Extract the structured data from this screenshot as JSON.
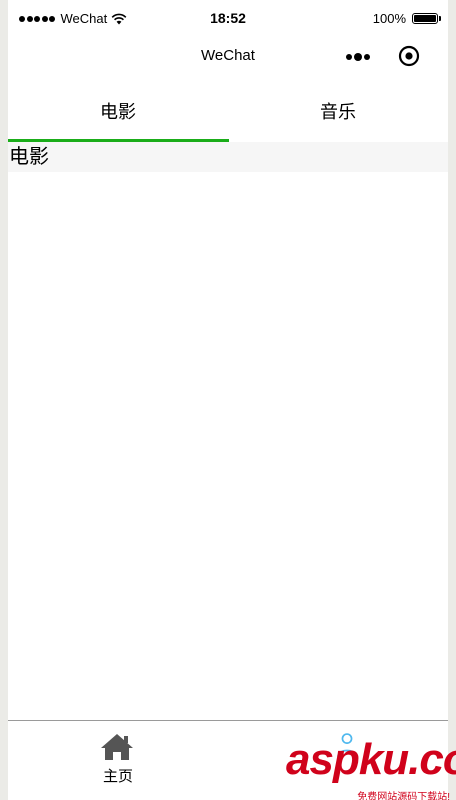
{
  "status_bar": {
    "carrier": "WeChat",
    "time": "18:52",
    "battery": "100%"
  },
  "nav_bar": {
    "title": "WeChat",
    "more_icon": "more-dots-icon",
    "target_icon": "record-target-icon"
  },
  "tabs": [
    {
      "label": "电影",
      "active": true
    },
    {
      "label": "音乐",
      "active": false
    }
  ],
  "content": {
    "heading": "电影"
  },
  "tabbar": {
    "items": [
      {
        "label": "主页",
        "icon": "home-icon"
      },
      {
        "label": "",
        "icon": "user-icon"
      }
    ]
  },
  "watermark": {
    "main": "aspku.com",
    "sub": "免费网站源码下载站!"
  },
  "colors": {
    "accent": "#1aad19",
    "user_icon": "#4fb8ee",
    "watermark": "#d0021b"
  }
}
